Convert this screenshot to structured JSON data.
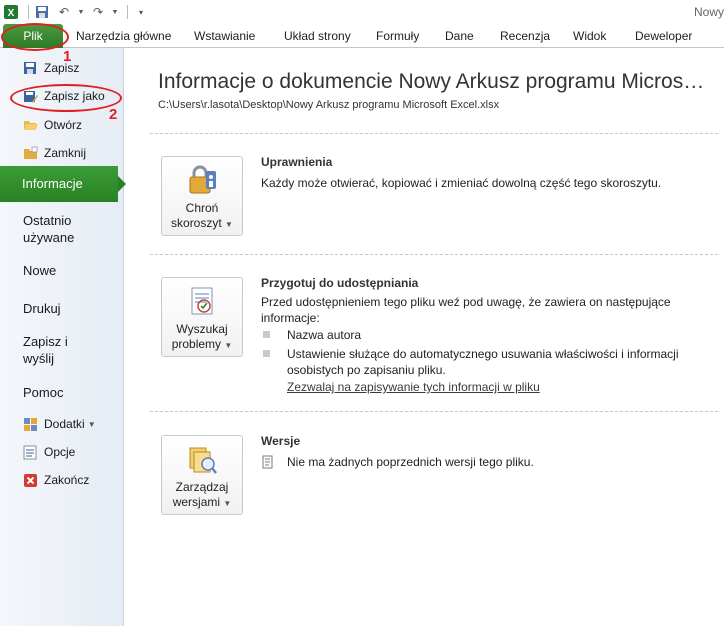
{
  "window": {
    "title_fragment": "Nowy"
  },
  "tabs": {
    "file": "Plik",
    "items": [
      "Narzędzia główne",
      "Wstawianie",
      "Układ strony",
      "Formuły",
      "Dane",
      "Recenzja",
      "Widok",
      "Deweloper"
    ]
  },
  "annotations": {
    "one": "1",
    "two": "2"
  },
  "left": {
    "zapisz": "Zapisz",
    "zapisz_jako": "Zapisz jako",
    "otworz": "Otwórz",
    "zamknij": "Zamknij",
    "informacje": "Informacje",
    "ostatnio_1": "Ostatnio",
    "ostatnio_2": "używane",
    "nowe": "Nowe",
    "drukuj": "Drukuj",
    "zapisz_wyslij_1": "Zapisz i",
    "zapisz_wyslij_2": "wyślij",
    "pomoc": "Pomoc",
    "dodatki": "Dodatki",
    "opcje": "Opcje",
    "zakoncz": "Zakończ"
  },
  "info": {
    "title": "Informacje o dokumencie Nowy Arkusz programu Micros…",
    "path": "C:\\Users\\r.lasota\\Desktop\\Nowy Arkusz programu Microsoft Excel.xlsx"
  },
  "permissions": {
    "button_1": "Chroń",
    "button_2": "skoroszyt",
    "title": "Uprawnienia",
    "text": "Każdy może otwierać, kopiować i zmieniać dowolną część tego skoroszytu."
  },
  "prepare": {
    "button_1": "Wyszukaj",
    "button_2": "problemy",
    "title": "Przygotuj do udostępniania",
    "text": "Przed udostępnieniem tego pliku weź pod uwagę, że zawiera on następujące informacje:",
    "bullet_1": "Nazwa autora",
    "bullet_2": "Ustawienie służące do automatycznego usuwania właściwości i informacji osobistych po zapisaniu pliku.",
    "link": "Zezwalaj na zapisywanie tych informacji w pliku"
  },
  "versions": {
    "button_1": "Zarządzaj",
    "button_2": "wersjami",
    "title": "Wersje",
    "text": "Nie ma żadnych poprzednich wersji tego pliku."
  },
  "colors": {
    "accent_green": "#2f7a26",
    "annotation_red": "#e02020"
  }
}
